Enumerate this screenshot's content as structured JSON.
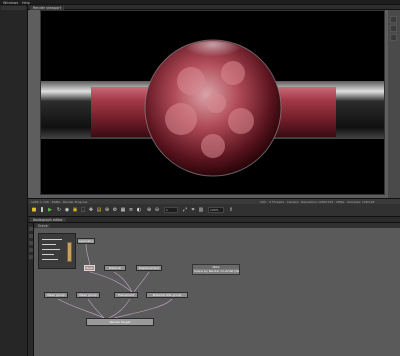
{
  "menu": {
    "items": [
      "Windows",
      "Help"
    ]
  },
  "viewer": {
    "tab_label": "Render viewport"
  },
  "status": {
    "left": "1280 × 720  ·  RGBA  ·  Render Progress",
    "right": "CPU · 4 Threads · Camera  ·  Resolution 1280x720 · 28fps · Samples: 128/128"
  },
  "toolbar": {
    "frame_value": "1",
    "zoom_value": "100%"
  },
  "nodegraph": {
    "tab_label": "Nodegraph editor",
    "subtab_label": "Scene",
    "nodes": {
      "top": "Geometry",
      "material": "Material",
      "displacement": "Displacement",
      "render_group_1": "Mesh group",
      "render_group_2": "Mesh group",
      "placement": "Placement",
      "render_target": "Render target",
      "main_group": "Material OSL group",
      "left_small": "Mesh"
    },
    "note": {
      "title": "Note",
      "text": "Scene by Render Co-Artist (developer)"
    }
  },
  "colors": {
    "accent": "#e3c21a",
    "go": "#5ec24a",
    "node": "#8e8e8e"
  }
}
